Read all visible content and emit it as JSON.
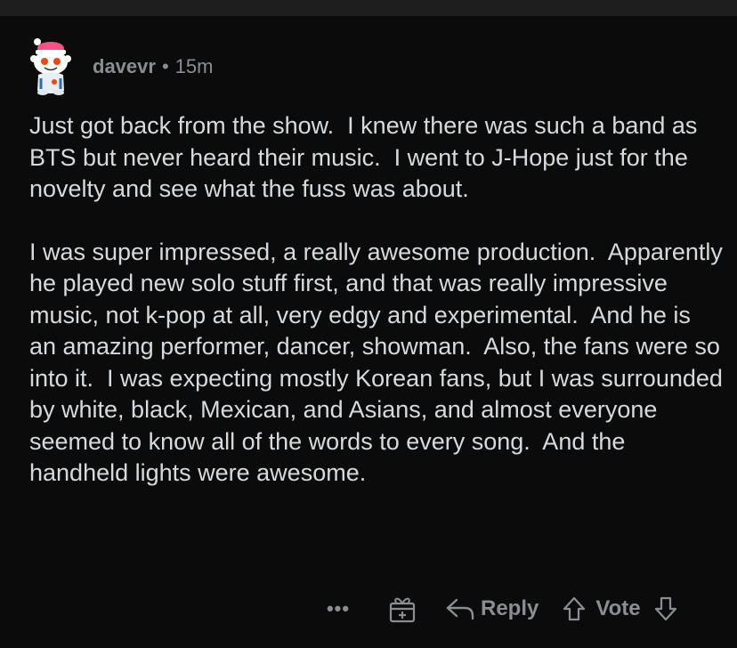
{
  "comment": {
    "username": "davevr",
    "separator": "•",
    "age": "15m",
    "paragraphs": [
      "Just got back from the show.  I knew there was such a band as BTS but never heard their music.  I went to J-Hope just for the novelty and see what the fuss was about.",
      "I was super impressed, a really awesome production.  Apparently he played new solo stuff first, and that was really impressive music, not k-pop at all, very edgy and experimental.  And he is an amazing performer, dancer, showman.  Also, the fans were so into it.  I was expecting mostly Korean fans, but I was surrounded by white, black, Mexican, and Asians, and almost everyone seemed to know all of the words to every song.  And the handheld lights were awesome."
    ]
  },
  "actions": {
    "more_label": "•••",
    "reply_label": "Reply",
    "vote_label": "Vote"
  },
  "icons": {
    "avatar": "snoo-avatar-icon",
    "award": "gift-award-icon",
    "reply": "reply-arrow-icon",
    "upvote": "upvote-arrow-icon",
    "downvote": "downvote-arrow-icon"
  },
  "colors": {
    "background": "#0b0b0b",
    "text": "#d7dadc",
    "muted": "#8a8d91",
    "topbar": "#1e1e1e"
  }
}
